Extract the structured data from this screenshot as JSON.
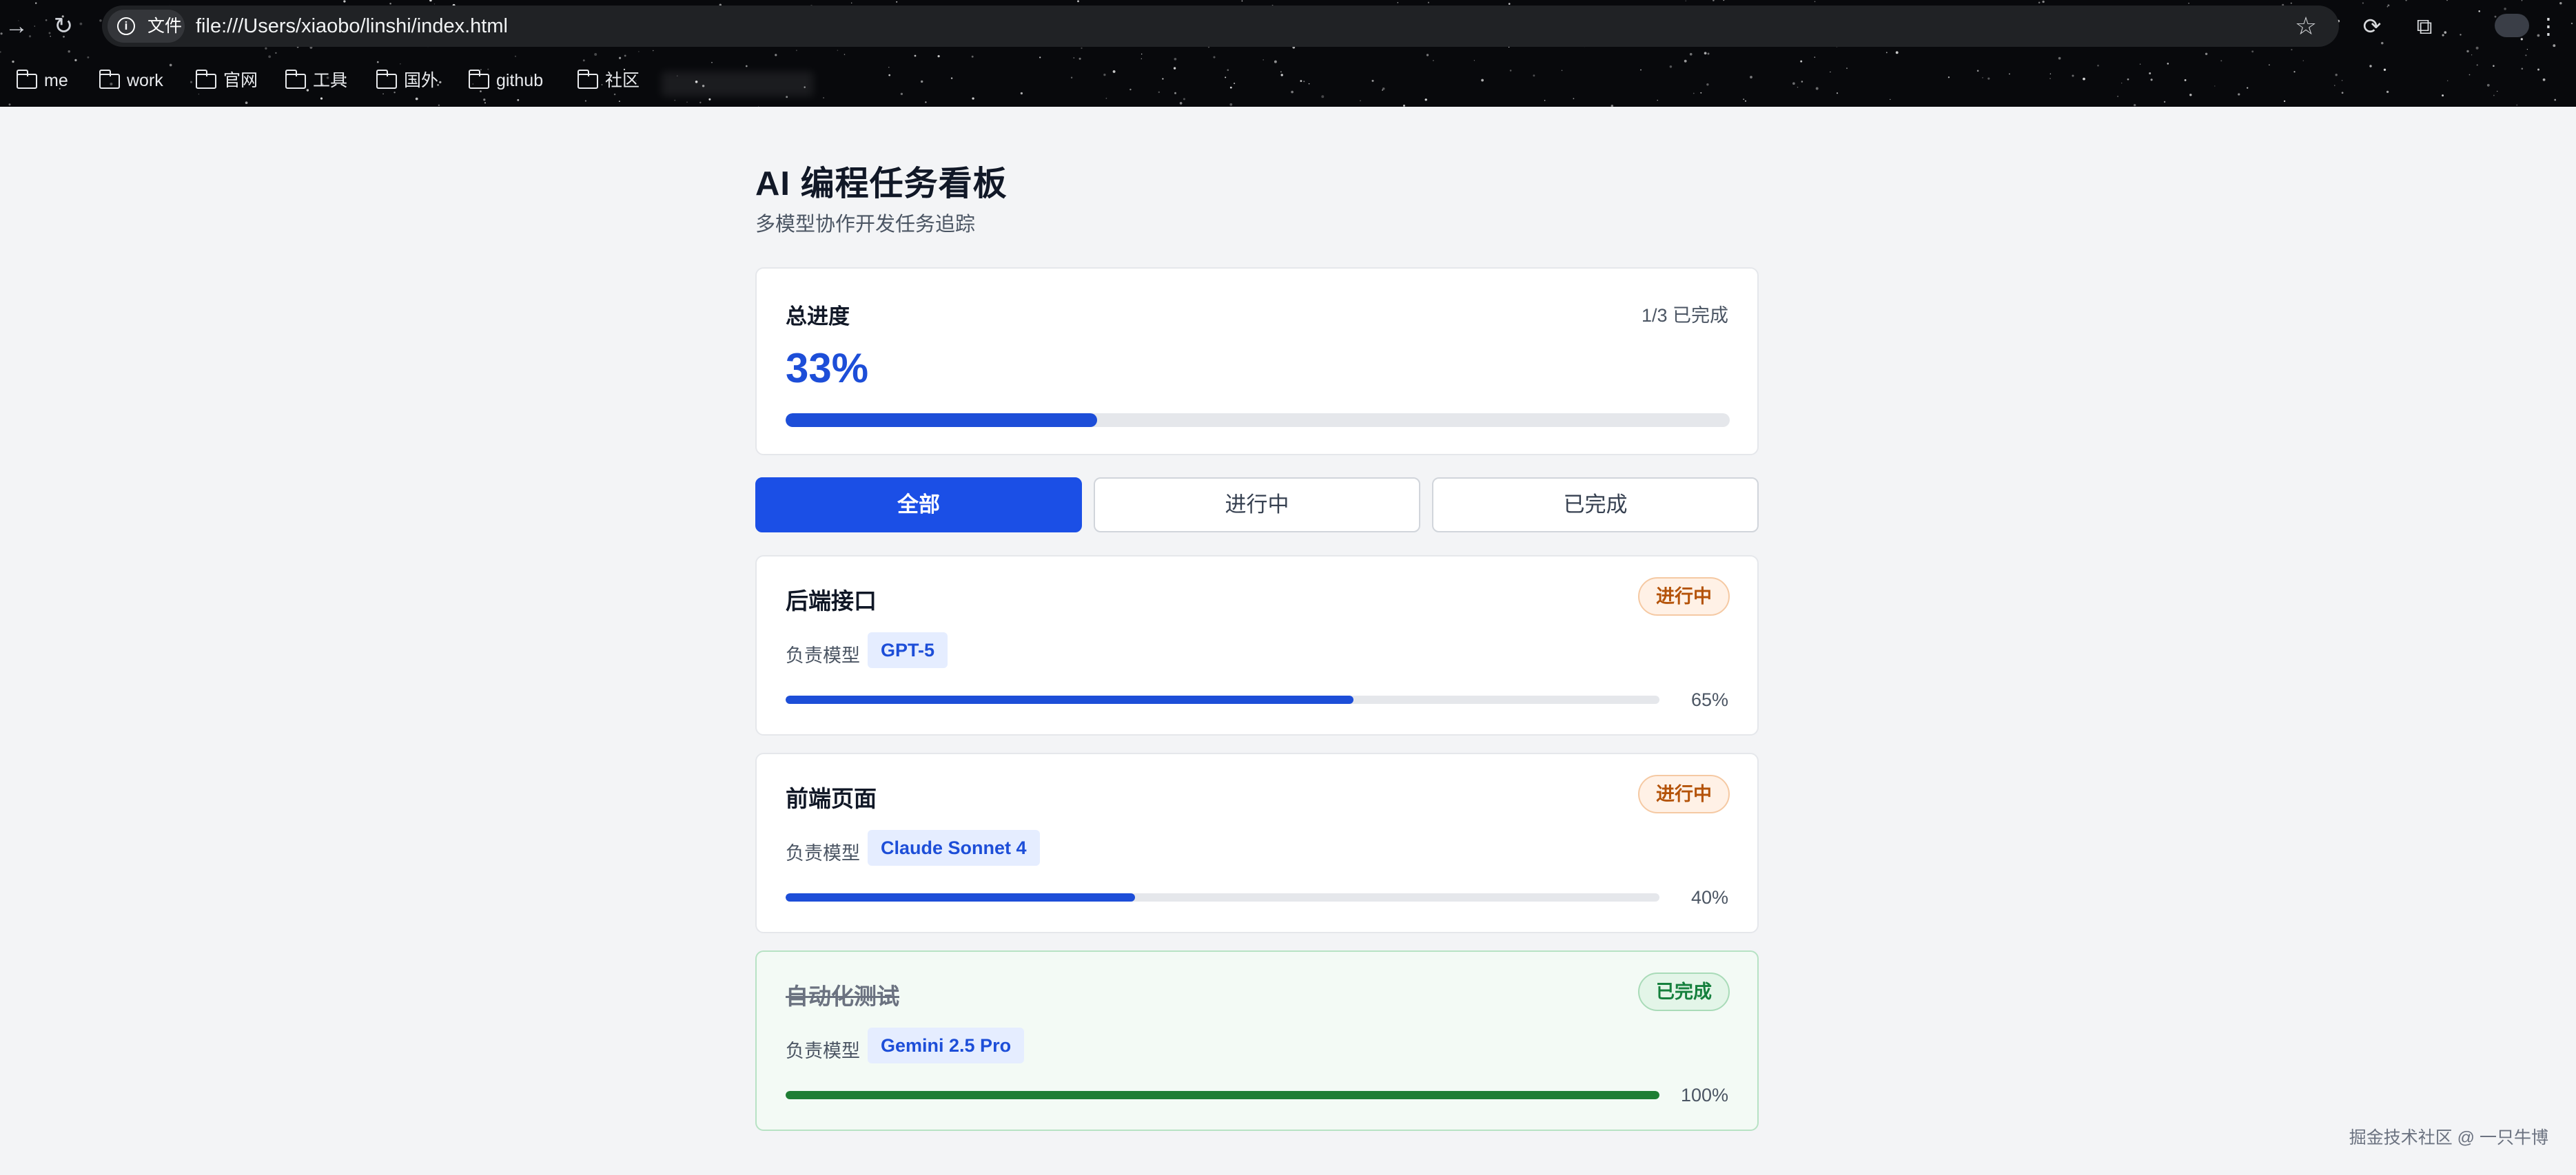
{
  "browser": {
    "site_chip": "文件",
    "url": "file:///Users/xiaobo/linshi/index.html",
    "bookmarks": [
      {
        "label": "me"
      },
      {
        "label": "work"
      },
      {
        "label": "官网"
      },
      {
        "label": "工具"
      },
      {
        "label": "国外"
      },
      {
        "label": "github"
      },
      {
        "label": "社区"
      }
    ]
  },
  "page": {
    "title": "AI 编程任务看板",
    "subtitle": "多模型协作开发任务追踪"
  },
  "overall": {
    "label": "总进度",
    "count": "1/3 已完成",
    "percent_text": "33%",
    "progress": 0.33
  },
  "filters": [
    {
      "label": "全部",
      "active": true
    },
    {
      "label": "进行中",
      "active": false
    },
    {
      "label": "已完成",
      "active": false
    }
  ],
  "tasks": [
    {
      "title": "后端接口",
      "status": "进行中",
      "model_label": "负责模型",
      "model": "GPT-5",
      "percent_text": "65%",
      "progress": 0.65
    },
    {
      "title": "前端页面",
      "status": "进行中",
      "model_label": "负责模型",
      "model": "Claude Sonnet 4",
      "percent_text": "40%",
      "progress": 0.4
    },
    {
      "title": "自动化测试",
      "status": "已完成",
      "model_label": "负责模型",
      "model": "Gemini 2.5 Pro",
      "percent_text": "100%",
      "progress": 1.0
    }
  ],
  "watermark": "掘金技术社区 @ 一只牛博",
  "colors": {
    "accent": "#1b4fe6",
    "in_progress": "#b45309",
    "complete": "#15803d"
  },
  "icons": [
    "back-arrow-icon",
    "reload-icon",
    "info-icon",
    "bookmark-star-icon",
    "extension-icon",
    "puzzle-icon",
    "menu-icon",
    "folder-icon"
  ]
}
